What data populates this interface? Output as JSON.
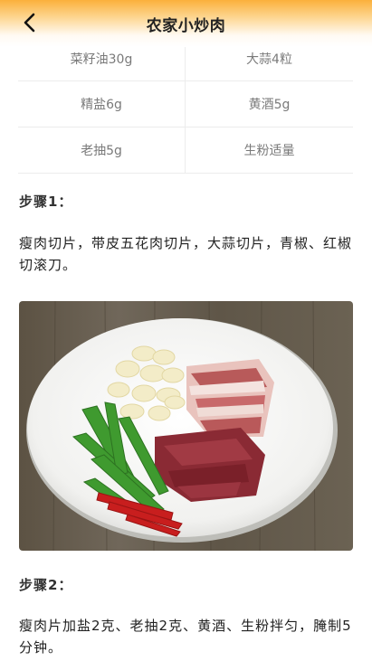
{
  "header": {
    "title": "农家小炒肉"
  },
  "ingredients": [
    [
      "菜籽油30g",
      "大蒜4粒"
    ],
    [
      "精盐6g",
      "黄酒5g"
    ],
    [
      "老抽5g",
      "生粉适量"
    ]
  ],
  "steps": [
    {
      "label": "步骤1：",
      "text": "瘦肉切片，带皮五花肉切片，大蒜切片，青椒、红椒切滚刀。",
      "image": "sliced pork, garlic and peppers on a white plate"
    },
    {
      "label": "步骤2：",
      "text": "瘦肉片加盐2克、老抽2克、黄酒、生粉拌匀，腌制5分钟。"
    }
  ],
  "icons": {
    "back": "chevron-left-icon"
  }
}
